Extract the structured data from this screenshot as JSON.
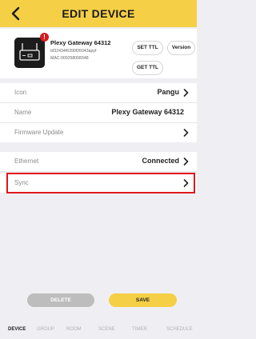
{
  "header": {
    "title": "EDIT DEVICE"
  },
  "device": {
    "name": "Plexy Gateway 64312",
    "id": "bf32434f6390f26043apyf",
    "mac": "MAC:000258008348",
    "buttons": {
      "set_ttl": "SET TTL",
      "version": "Version",
      "get_ttl": "GET TTL"
    },
    "alert_badge": "!"
  },
  "rows": {
    "icon": {
      "label": "Icon",
      "value": "Pangu"
    },
    "name": {
      "label": "Name",
      "value": "Plexy Gateway 64312"
    },
    "firmware": {
      "label": "Firmware Update"
    },
    "ethernet": {
      "label": "Ethernet",
      "value": "Connected"
    },
    "sync": {
      "label": "Sync"
    }
  },
  "actions": {
    "delete": "DELETE",
    "save": "SAVE"
  },
  "tabs": [
    {
      "label": "DEVICE",
      "active": true
    },
    {
      "label": "GROUP"
    },
    {
      "label": "ROOM"
    },
    {
      "label": "SCENE"
    },
    {
      "label": "TIMER"
    },
    {
      "label": "SCHEDULE"
    }
  ],
  "colors": {
    "accent": "#f5cf45",
    "highlight": "#e0161c",
    "alert": "#d31d1d"
  },
  "icons": {
    "back": "chevron-left-icon",
    "row": "chevron-right-icon",
    "device": "gateway-router-icon"
  }
}
